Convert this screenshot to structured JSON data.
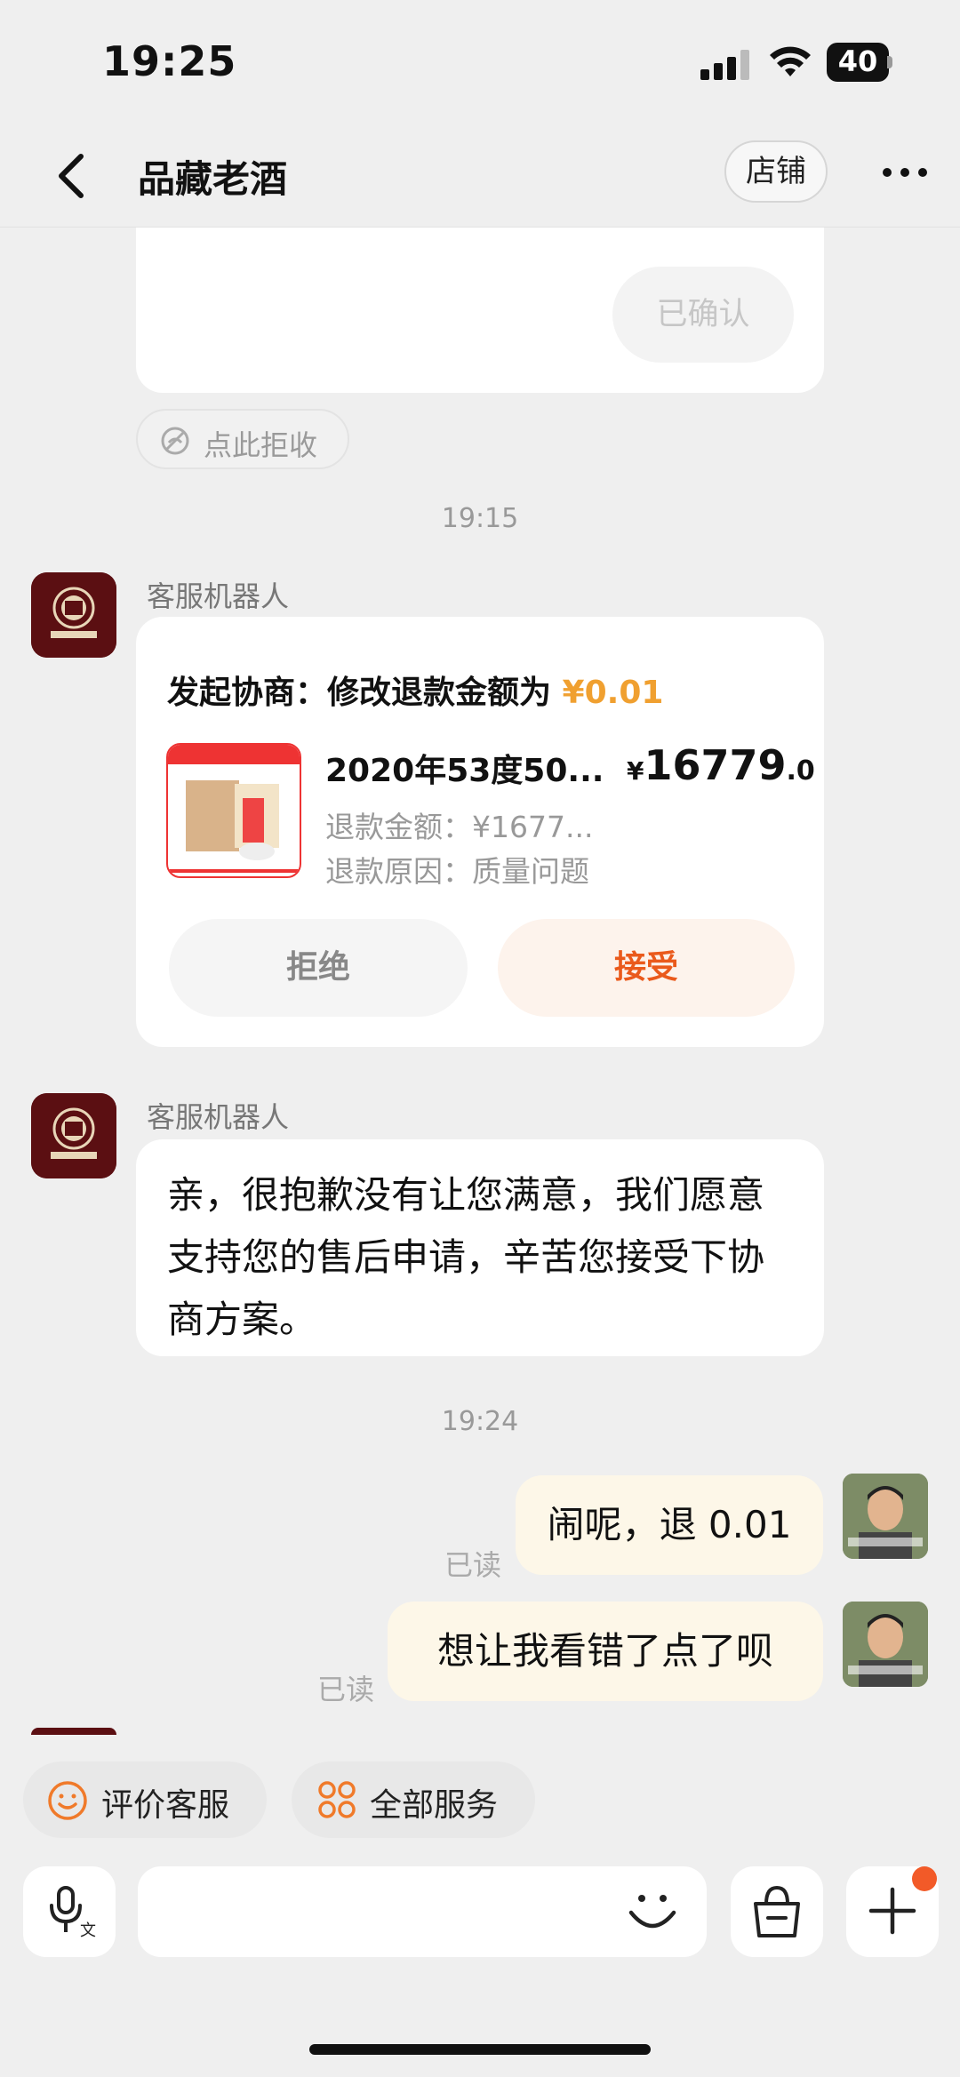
{
  "status_bar": {
    "time": "19:25",
    "battery": "40"
  },
  "header": {
    "title": "品藏老酒",
    "shop_label": "店铺"
  },
  "top_card": {
    "confirmed_label": "已确认"
  },
  "reject_chip": {
    "label": "点此拒收"
  },
  "timestamps": [
    "19:15",
    "19:24"
  ],
  "messages": [
    {
      "sender": "客服机器人",
      "type": "negotiation",
      "title_prefix": "发起协商：修改退款金额为 ",
      "title_amount": "¥0.01",
      "product_name": "2020年53度50...",
      "price_currency": "¥",
      "price_main": "16779",
      "price_decimal": ".0",
      "refund_amount": "退款金额：¥1677...",
      "refund_reason": "退款原因：质量问题",
      "refuse_label": "拒绝",
      "accept_label": "接受"
    },
    {
      "sender": "客服机器人",
      "type": "text",
      "text": "亲，很抱歉没有让您满意，我们愿意支持您的售后申请，辛苦您接受下协商方案。"
    }
  ],
  "my_messages": [
    {
      "text": "闹呢，退 0.01",
      "read": "已读"
    },
    {
      "text": "想让我看错了点了呗",
      "read": "已读"
    }
  ],
  "bottom": {
    "rate_label": "评价客服",
    "all_services_label": "全部服务"
  },
  "colors": {
    "accent": "#ea5a1c",
    "amount": "#f0a030",
    "bubble": "#fdf7e8"
  }
}
